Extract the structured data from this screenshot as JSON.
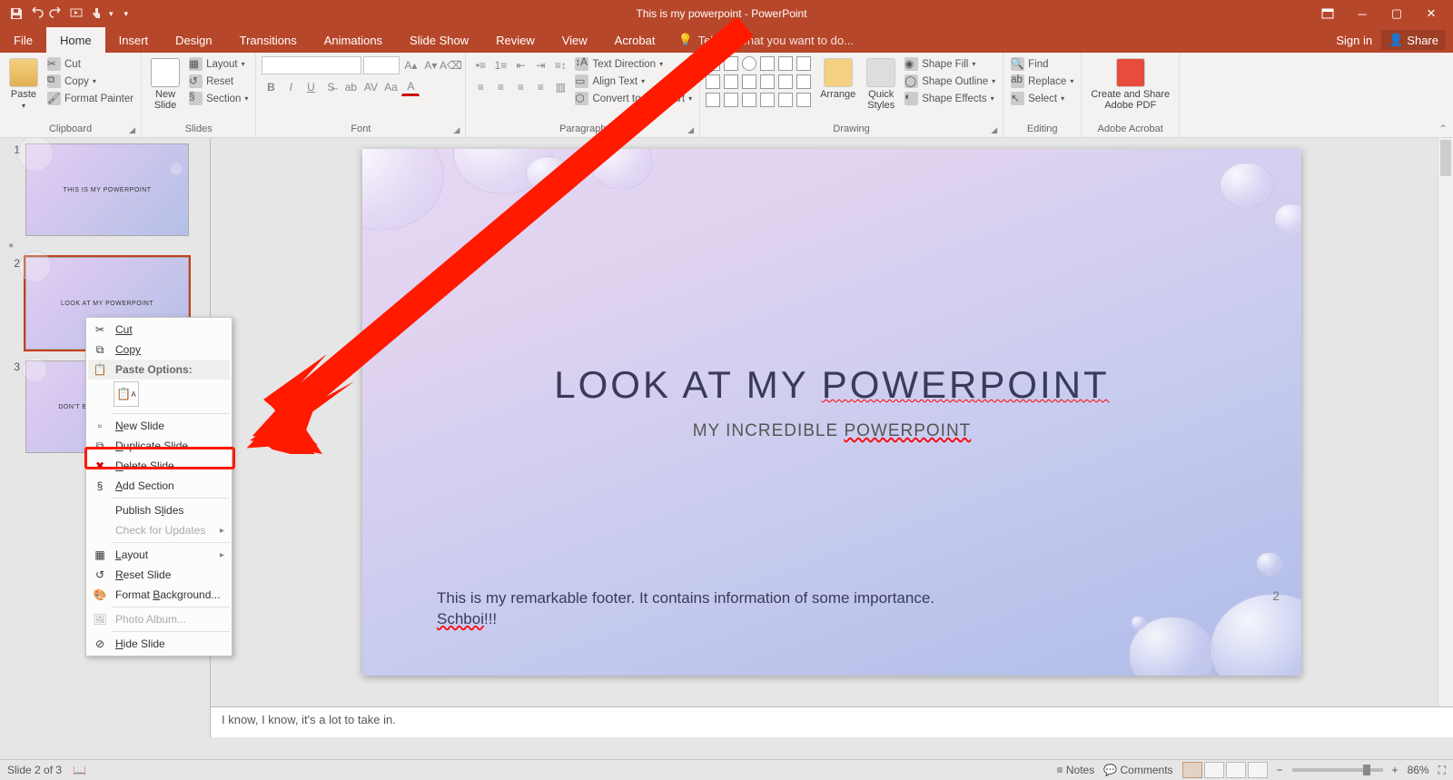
{
  "title": "This is my powerpoint - PowerPoint",
  "tabs": {
    "file": "File",
    "home": "Home",
    "insert": "Insert",
    "design": "Design",
    "transitions": "Transitions",
    "animations": "Animations",
    "slideshow": "Slide Show",
    "review": "Review",
    "view": "View",
    "acrobat": "Acrobat"
  },
  "tellme": "Tell me what you want to do...",
  "signin": "Sign in",
  "share": "Share",
  "ribbon": {
    "clipboard": {
      "paste": "Paste",
      "cut": "Cut",
      "copy": "Copy",
      "format_painter": "Format Painter",
      "label": "Clipboard"
    },
    "slides": {
      "new_slide": "New\nSlide",
      "layout": "Layout",
      "reset": "Reset",
      "section": "Section",
      "label": "Slides"
    },
    "font": {
      "label": "Font"
    },
    "paragraph": {
      "text_dir": "Text Direction",
      "align": "Align Text",
      "smartart": "Convert to SmartArt",
      "label": "Paragraph"
    },
    "drawing": {
      "arrange": "Arrange",
      "quick_styles": "Quick\nStyles",
      "shape_fill": "Shape Fill",
      "shape_outline": "Shape Outline",
      "shape_effects": "Shape Effects",
      "label": "Drawing"
    },
    "editing": {
      "find": "Find",
      "replace": "Replace",
      "select": "Select",
      "label": "Editing"
    },
    "adobe": {
      "btn": "Create and Share\nAdobe PDF",
      "label": "Adobe Acrobat"
    }
  },
  "thumbs": {
    "n1": "1",
    "t1": "THIS IS MY POWERPOINT",
    "n2": "2",
    "t2": "LOOK AT MY POWERPOINT",
    "n3": "3",
    "t3": "DON'T BE TOO INTIMIDATED"
  },
  "slide": {
    "title_a": "LOOK AT MY ",
    "title_b": "POWERPOINT",
    "sub_a": "MY INCREDIBLE ",
    "sub_b": "POWERPOINT",
    "footer_a": "This is my remarkable footer. It contains information of some importance. ",
    "footer_b": "Schboi",
    "footer_c": "!!!",
    "page": "2"
  },
  "notes": "I know, I know, it's a lot to take in.",
  "ctx": {
    "cut": "Cut",
    "copy": "Copy",
    "paste_options": "Paste Options:",
    "new_slide_a": "N",
    "new_slide_b": "ew Slide",
    "duplicate_a": "D",
    "duplicate_b": "uplicate Slide",
    "delete_a": "D",
    "delete_b": "elete Slide",
    "add_section_a": "A",
    "add_section_b": "dd Section",
    "publish_a": "Publish S",
    "publish_b": "l",
    "publish_c": "ides",
    "check_updates": "Check for Updates",
    "layout_a": "L",
    "layout_b": "ayout",
    "reset_a": "R",
    "reset_b": "eset Slide",
    "format_bg_a": "Format ",
    "format_bg_b": "B",
    "format_bg_c": "ackground...",
    "photo_album": "Photo Album...",
    "hide_a": "H",
    "hide_b": "ide Slide"
  },
  "status": {
    "slide": "Slide 2 of 3",
    "notes": "Notes",
    "comments": "Comments",
    "zoom": "86%"
  }
}
